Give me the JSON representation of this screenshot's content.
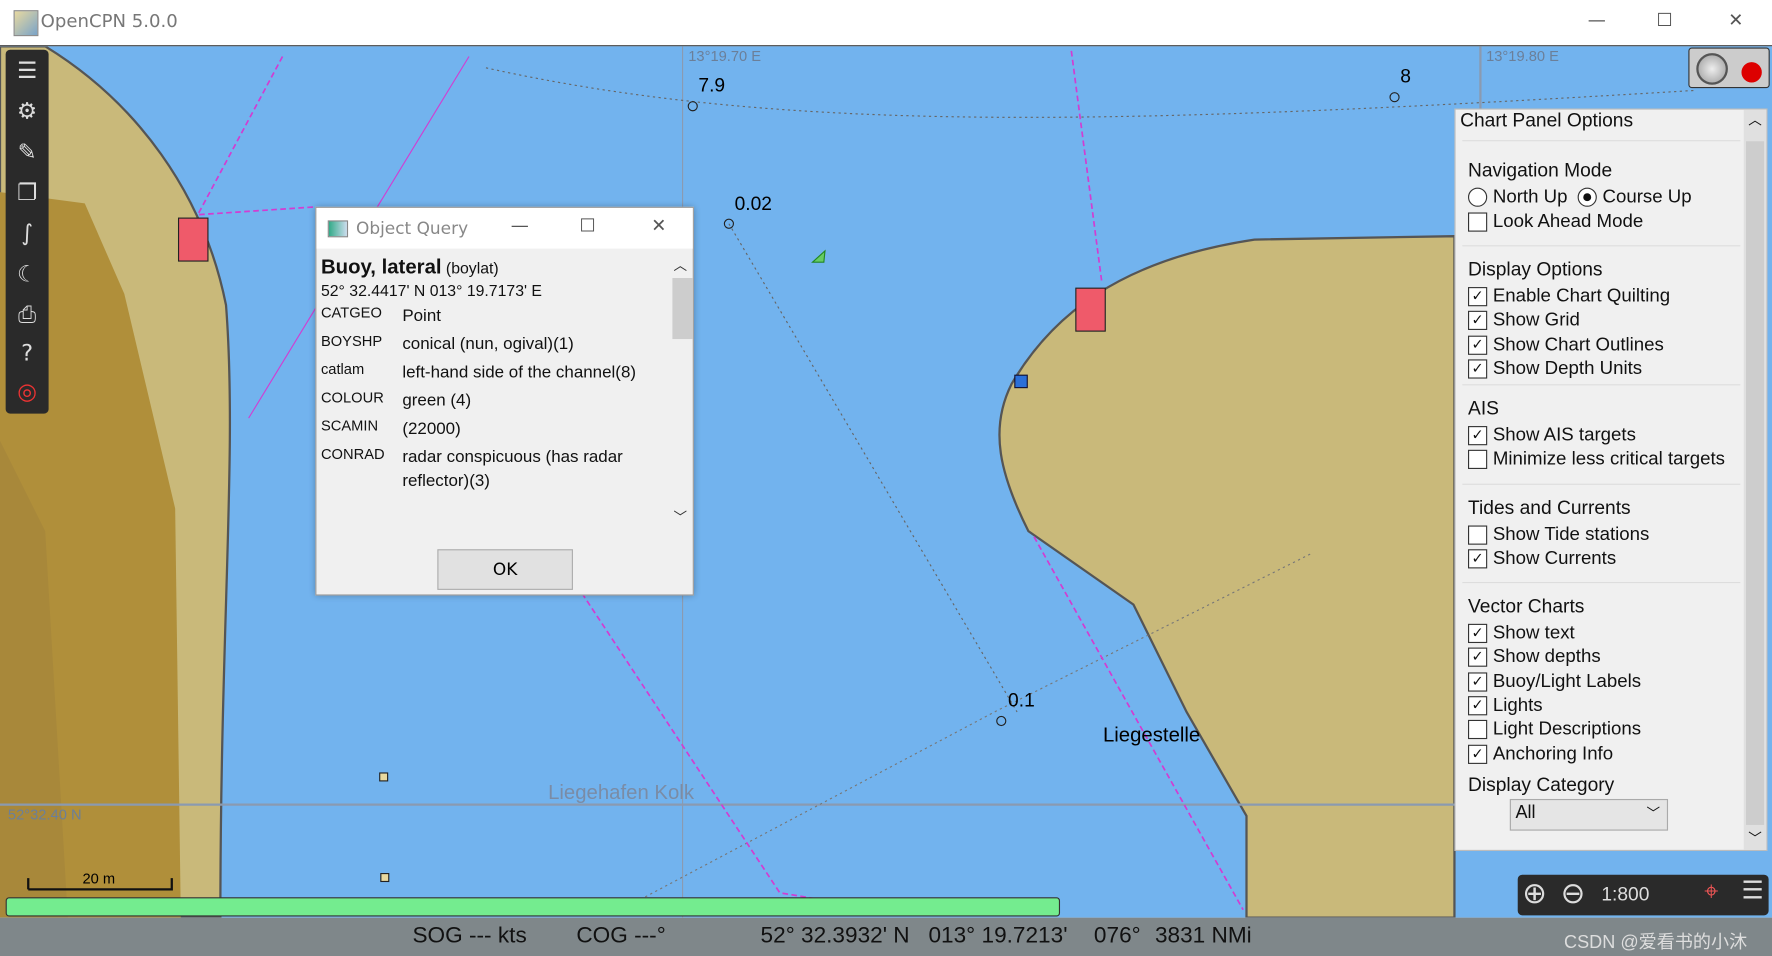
{
  "window": {
    "title": "OpenCPN 5.0.0",
    "minimize": "—",
    "maximize": "☐",
    "close": "✕"
  },
  "map": {
    "colors": {
      "water": "#72b3ee",
      "land": "#c9b97a",
      "land_dark": "#b08f3a",
      "route": "#d23cd2"
    },
    "grid_labels": {
      "lon1": "13°19.70 E",
      "lon2": "13°19.80 E",
      "lat1": "52°32.40 N"
    },
    "depths": [
      "7.9",
      "8",
      "0.02",
      "0.1"
    ],
    "place_labels": {
      "liegestelle": "Liegestelle",
      "kolk": "Liegehafen Kolk"
    },
    "scale_bar": "20 m"
  },
  "toolbar": {
    "items": [
      "menu-icon",
      "settings-icon",
      "route-icon",
      "charts-icon",
      "track-icon",
      "night-mode-icon",
      "print-icon",
      "help-icon",
      "mob-icon"
    ]
  },
  "dialog": {
    "title": "Object Query",
    "object_name": "Buoy, lateral",
    "object_code": "(boylat)",
    "position": "52° 32.4417' N 013° 19.7173' E",
    "attributes": [
      {
        "key": "CATGEO",
        "value": "Point"
      },
      {
        "key": "BOYSHP",
        "value": "conical (nun, ogival)(1)"
      },
      {
        "key": "catlam",
        "value": "left-hand side of the channel(8)"
      },
      {
        "key": "COLOUR",
        "value": "green (4)"
      },
      {
        "key": "SCAMIN",
        "value": "(22000)"
      },
      {
        "key": "CONRAD",
        "value": "radar conspicuous (has radar reflector)(3)"
      }
    ],
    "ok_label": "OK"
  },
  "panel": {
    "title": "Chart Panel Options",
    "navigation": {
      "label": "Navigation Mode",
      "north_up": "North Up",
      "course_up": "Course Up",
      "selected": "course_up",
      "look_ahead": "Look Ahead Mode",
      "look_ahead_checked": false
    },
    "display": {
      "label": "Display Options",
      "items": [
        {
          "label": "Enable Chart Quilting",
          "checked": true
        },
        {
          "label": "Show Grid",
          "checked": true
        },
        {
          "label": "Show Chart Outlines",
          "checked": true
        },
        {
          "label": "Show Depth Units",
          "checked": true
        }
      ]
    },
    "ais": {
      "label": "AIS",
      "items": [
        {
          "label": "Show AIS targets",
          "checked": true
        },
        {
          "label": "Minimize less critical targets",
          "checked": false
        }
      ]
    },
    "tides": {
      "label": "Tides and Currents",
      "items": [
        {
          "label": "Show Tide stations",
          "checked": false
        },
        {
          "label": "Show Currents",
          "checked": true
        }
      ]
    },
    "vector": {
      "label": "Vector Charts",
      "items": [
        {
          "label": "Show text",
          "checked": true
        },
        {
          "label": "Show depths",
          "checked": true
        },
        {
          "label": "Buoy/Light Labels",
          "checked": true
        },
        {
          "label": "Lights",
          "checked": true
        },
        {
          "label": "Light Descriptions",
          "checked": false
        },
        {
          "label": "Anchoring Info",
          "checked": true
        }
      ]
    },
    "category": {
      "label": "Display Category",
      "value": "All"
    }
  },
  "zoom": {
    "scale": "1:800"
  },
  "status": {
    "sog": "SOG --- kts",
    "cog": "COG ---°",
    "position": "52° 32.3932' N   013° 19.7213'",
    "bearing": "076°",
    "distance": "3831 NMi",
    "watermark": "CSDN @爱看书的小沐"
  }
}
